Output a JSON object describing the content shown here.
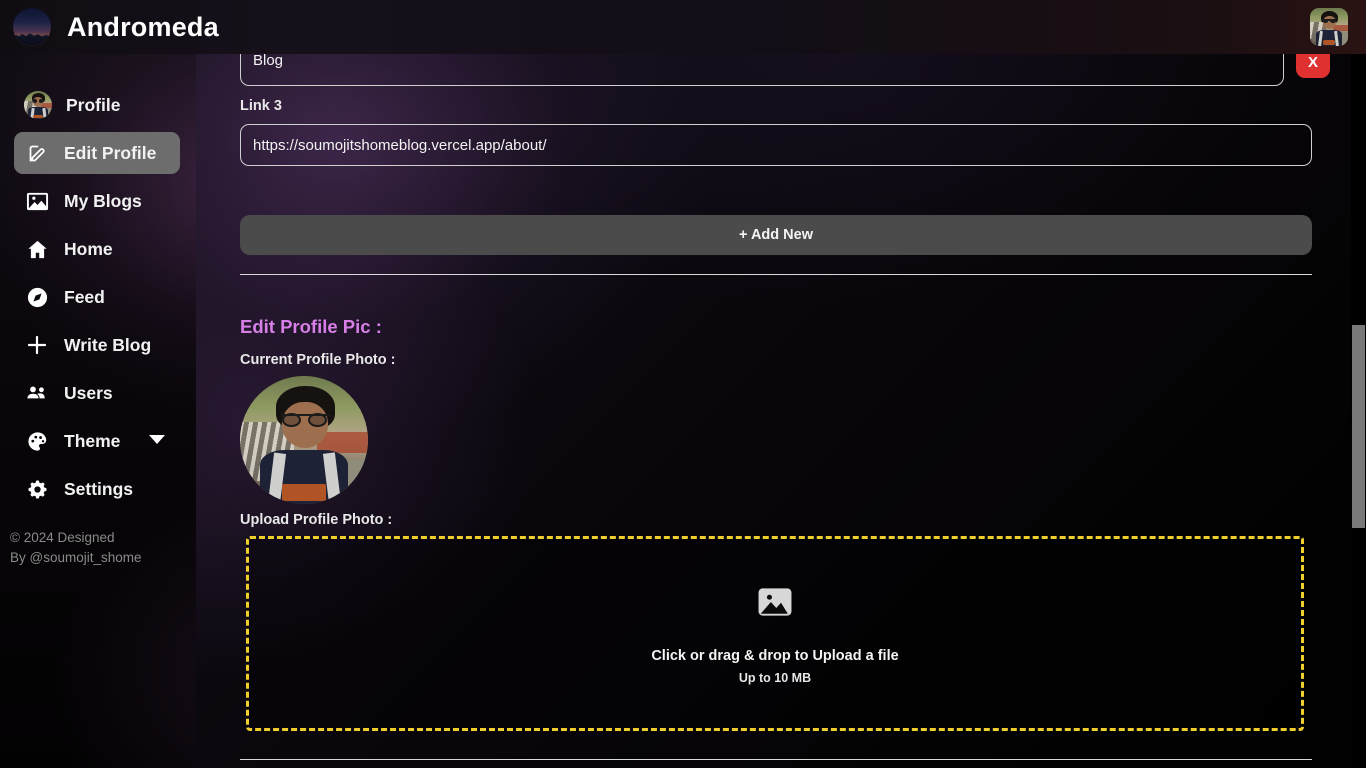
{
  "header": {
    "brand": "Andromeda",
    "logo_icon": "night-sky-logo",
    "avatar_icon": "user-avatar"
  },
  "sidebar": {
    "items": [
      {
        "label": "Profile",
        "icon": "avatar-icon",
        "active": false,
        "caret": false
      },
      {
        "label": "Edit Profile",
        "icon": "edit-square-icon",
        "active": true,
        "caret": false
      },
      {
        "label": "My Blogs",
        "icon": "image-icon",
        "active": false,
        "caret": false
      },
      {
        "label": "Home",
        "icon": "home-icon",
        "active": false,
        "caret": false
      },
      {
        "label": "Feed",
        "icon": "compass-icon",
        "active": false,
        "caret": false
      },
      {
        "label": "Write Blog",
        "icon": "plus-icon",
        "active": false,
        "caret": false
      },
      {
        "label": "Users",
        "icon": "users-icon",
        "active": false,
        "caret": false
      },
      {
        "label": "Theme",
        "icon": "palette-icon",
        "active": false,
        "caret": true
      },
      {
        "label": "Settings",
        "icon": "gear-icon",
        "active": false,
        "caret": false
      }
    ],
    "copyright_line1": "© 2024 Designed",
    "copyright_line2": "By @soumojit_shome"
  },
  "main": {
    "clipped_link": {
      "value": "Blog",
      "remove_label": "X"
    },
    "link3": {
      "label": "Link 3",
      "value": "https://soumojitshomeblog.vercel.app/about/"
    },
    "add_new_label": "+ Add New",
    "profile_pic": {
      "heading": "Edit Profile Pic :",
      "current_label": "Current Profile Photo :",
      "upload_label": "Upload Profile Photo :",
      "current_photo_icon": "current-profile-photo"
    },
    "dropzone": {
      "icon": "image-placeholder-icon",
      "main_text": "Click or drag & drop to Upload a file",
      "sub_text": "Up to 10 MB"
    }
  },
  "colors": {
    "accent_heading": "#d77fe6",
    "dropzone_border": "#f0ce2e",
    "remove_button": "#e03131",
    "active_nav": "#6d6d6d",
    "add_new_button": "#4b4b4b",
    "scrollbar_thumb": "#797979"
  }
}
